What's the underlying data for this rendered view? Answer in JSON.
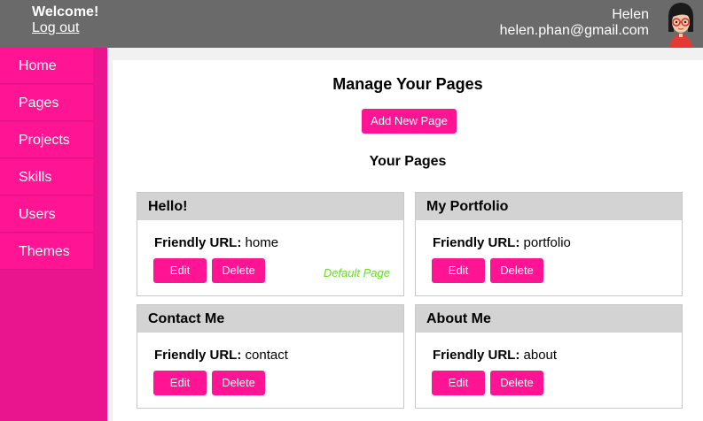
{
  "header": {
    "welcome": "Welcome!",
    "logout": "Log out",
    "user_name": "Helen",
    "user_email": "helen.phan@gmail.com"
  },
  "sidebar": {
    "items": [
      {
        "label": "Home"
      },
      {
        "label": "Pages"
      },
      {
        "label": "Projects"
      },
      {
        "label": "Skills"
      },
      {
        "label": "Users"
      },
      {
        "label": "Themes"
      }
    ]
  },
  "main": {
    "title": "Manage Your Pages",
    "add_button": "Add New Page",
    "subtitle": "Your Pages",
    "url_label": "Friendly URL:",
    "edit_label": "Edit",
    "delete_label": "Delete",
    "pages": [
      {
        "title": "Hello!",
        "url": "home",
        "tag": "Default Page"
      },
      {
        "title": "My Portfolio",
        "url": "portfolio"
      },
      {
        "title": "Contact Me",
        "url": "contact"
      },
      {
        "title": "About Me",
        "url": "about"
      }
    ]
  },
  "colors": {
    "accent": "#ff1493",
    "sidebar": "#e8158f",
    "topbar": "#6a6a6a",
    "default_tag": "#66dd22"
  }
}
